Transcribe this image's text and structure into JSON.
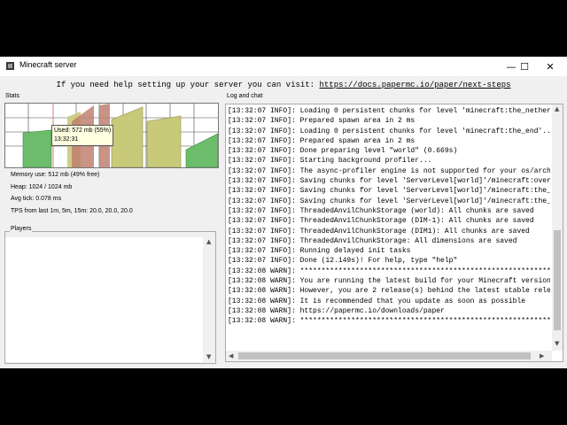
{
  "window": {
    "title": "Minecraft server",
    "minimize_glyph": "—",
    "maximize_glyph": "☐",
    "close_glyph": "✕"
  },
  "help": {
    "text": "If you need help setting up your server you can visit: ",
    "link": "https://docs.papermc.io/paper/next-steps"
  },
  "stats": {
    "label": "Stats",
    "tooltip_used": "Used: 572 mb (55%)",
    "tooltip_time": "13:32:31",
    "memory": "Memory use: 512 mb (49% free)",
    "heap": "Heap: 1024 / 1024 mb",
    "avg_tick": "Avg tick: 0.078 ms",
    "tps": "TPS from last 1m, 5m, 15m: 20.0, 20.0, 20.0"
  },
  "players": {
    "label": "Players"
  },
  "log": {
    "label": "Log and chat",
    "lines": [
      "[13:32:07 INFO]: Loading 0 persistent chunks for level 'minecraft:the_nether",
      "[13:32:07 INFO]: Prepared spawn area in 2 ms",
      "[13:32:07 INFO]: Loading 0 persistent chunks for level 'minecraft:the_end'..",
      "[13:32:07 INFO]: Prepared spawn area in 2 ms",
      "[13:32:07 INFO]: Done preparing level \"world\" (0.669s)",
      "[13:32:07 INFO]: Starting background profiler...",
      "[13:32:07 INFO]: The async-profiler engine is not supported for your os/arch",
      "[13:32:07 INFO]: Saving chunks for level 'ServerLevel[world]'/minecraft:over",
      "[13:32:07 INFO]: Saving chunks for level 'ServerLevel[world]'/minecraft:the_",
      "[13:32:07 INFO]: Saving chunks for level 'ServerLevel[world]'/minecraft:the_",
      "[13:32:07 INFO]: ThreadedAnvilChunkStorage (world): All chunks are saved",
      "[13:32:07 INFO]: ThreadedAnvilChunkStorage (DIM-1): All chunks are saved",
      "[13:32:07 INFO]: ThreadedAnvilChunkStorage (DIM1): All chunks are saved",
      "[13:32:07 INFO]: ThreadedAnvilChunkStorage: All dimensions are saved",
      "[13:32:07 INFO]: Running delayed init tasks",
      "[13:32:07 INFO]: Done (12.149s)! For help, type \"help\"",
      "[13:32:08 WARN]: ***************************************************************",
      "[13:32:08 WARN]: You are running the latest build for your Minecraft version",
      "[13:32:08 WARN]: However, you are 2 release(s) behind the latest stable rele",
      "[13:32:08 WARN]: It is recommended that you update as soon as possible",
      "[13:32:08 WARN]: https://papermc.io/downloads/paper",
      "[13:32:08 WARN]: ***************************************************************"
    ]
  },
  "colors": {
    "graph_green": "#6bbd6b",
    "graph_yellow": "#c9c97a",
    "graph_red": "#c08070"
  }
}
